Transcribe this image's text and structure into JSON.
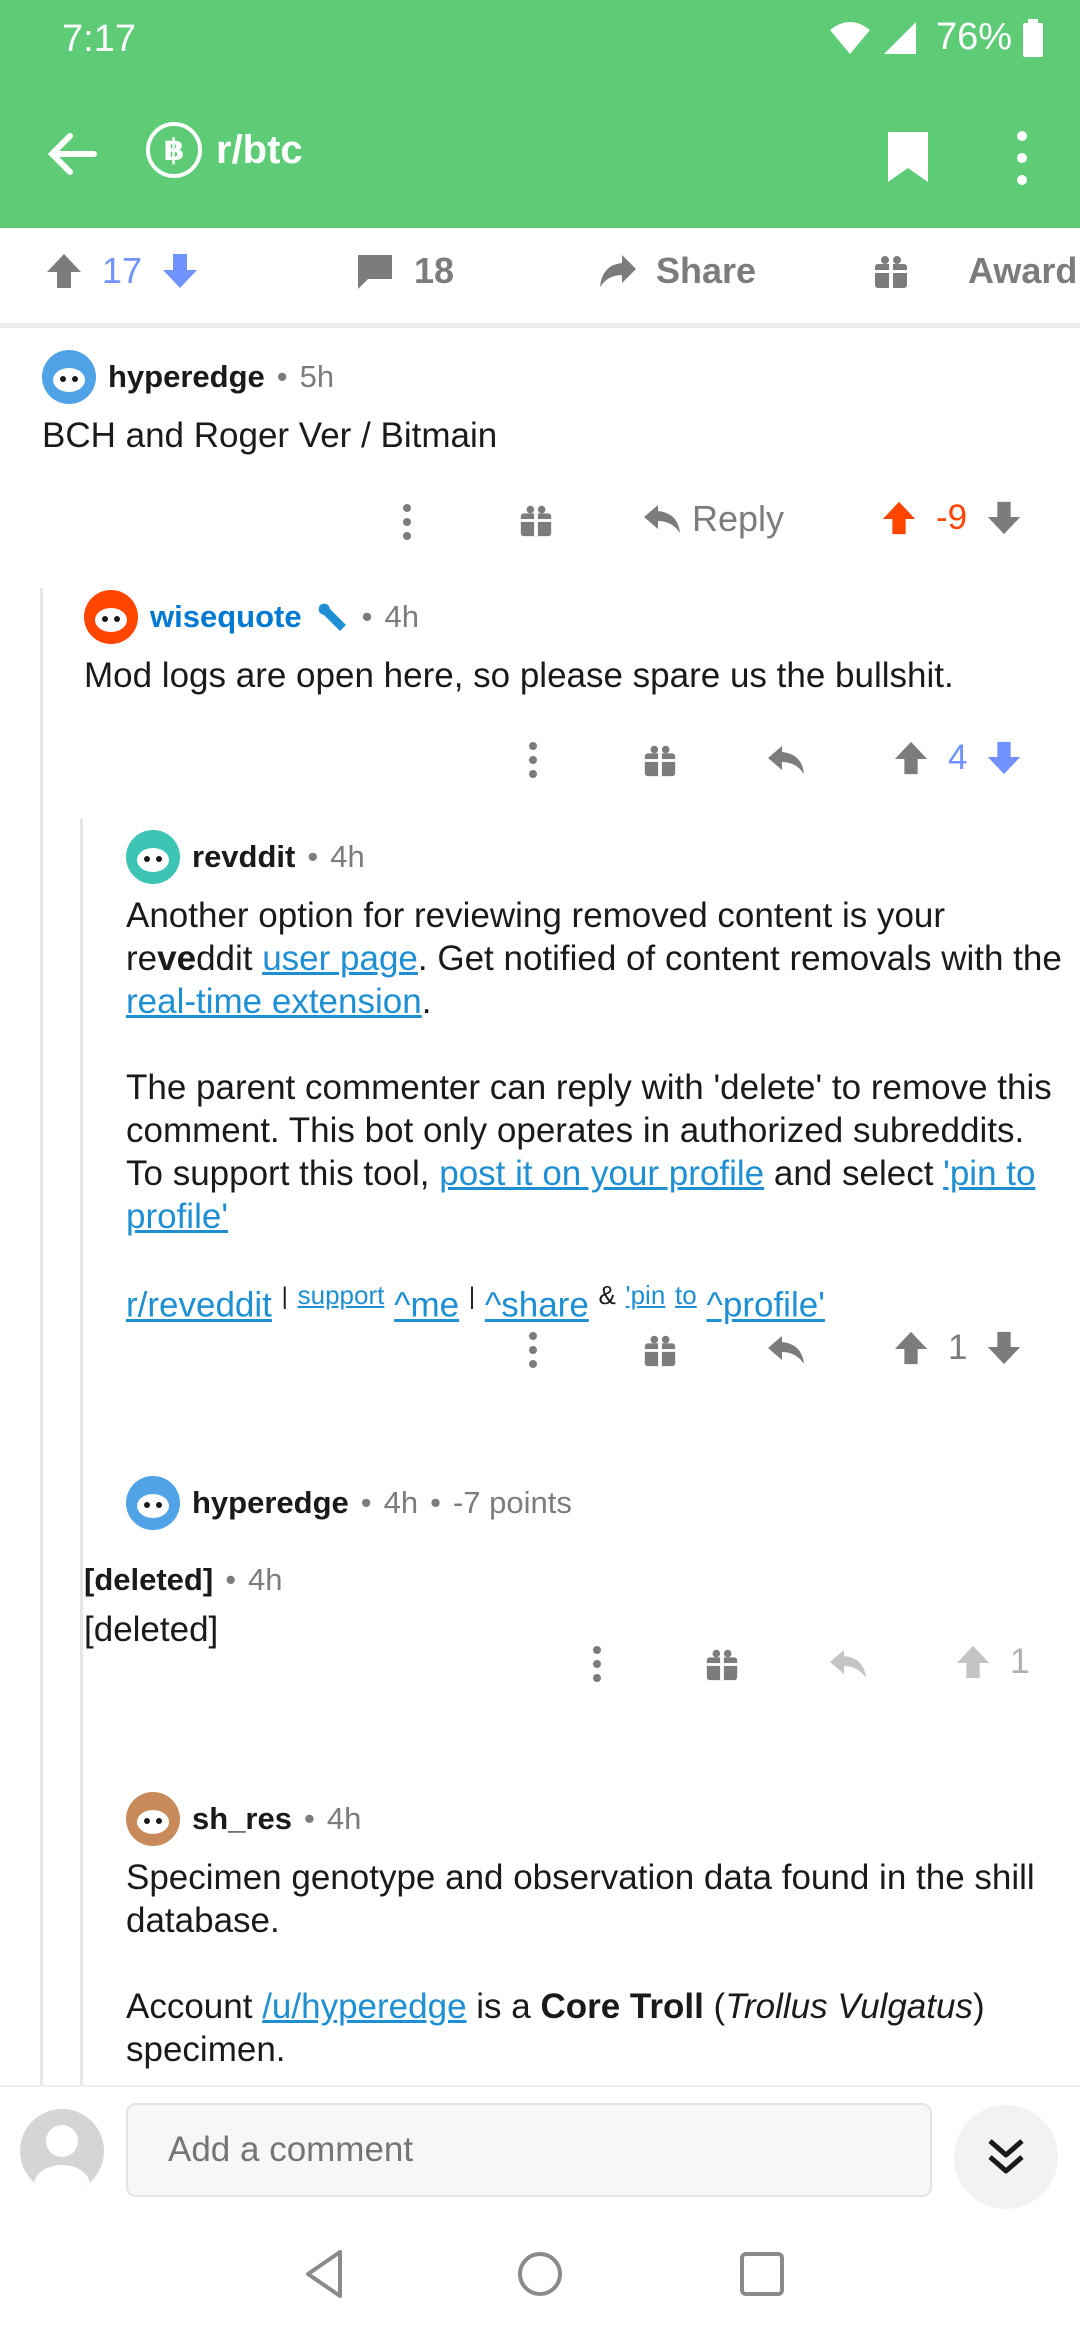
{
  "status_bar": {
    "time": "7:17",
    "battery": "76%",
    "icons": [
      "wifi-icon",
      "cell-signal-icon",
      "battery-icon"
    ]
  },
  "header": {
    "subreddit": "r/btc",
    "subreddit_icon_glyph": "฿"
  },
  "post_actions": {
    "score": "17",
    "comments": "18",
    "share": "Share",
    "award": "Award"
  },
  "comments": [
    {
      "user": "hyperedge",
      "time": "5h",
      "body": "BCH and Roger Ver / Bitmain",
      "reply": "Reply",
      "score": "-9"
    },
    {
      "user": "wisequote",
      "time": "4h",
      "body": "Mod logs are open here, so please spare us the bullshit.",
      "score": "4"
    },
    {
      "user": "revddit",
      "time": "4h",
      "p1_a": "Another option for reviewing removed content is your re",
      "p1_bold": "ve",
      "p1_b": "ddit ",
      "p1_link1": "user page",
      "p1_c": ". Get notified of content removals with the ",
      "p1_link2": "real-time extension",
      "p1_d": ".",
      "p2_a": "The parent commenter can reply with 'delete' to remove this comment. This bot only operates in authorized subreddits. To support this tool, ",
      "p2_link": "post it on your profile",
      "p2_b": " and select ",
      "p2_link2": "'pin to profile'",
      "links": {
        "reveddit": "r/reveddit",
        "sep1": "|",
        "support": "support",
        "me": "^me",
        "sep2": "|",
        "share": "^share",
        "amp": "&",
        "pin": "'pin",
        "to": "to",
        "profile": "^profile'"
      },
      "score": "1"
    },
    {
      "user": "hyperedge",
      "time": "4h",
      "points": "-7 points"
    },
    {
      "user": "[deleted]",
      "time": "4h",
      "body": "[deleted]",
      "score": "1"
    },
    {
      "user": "sh_res",
      "time": "4h",
      "p1": "Specimen genotype and observation data found in the shill database.",
      "p2_a": "Account ",
      "p2_link": "/u/hyperedge",
      "p2_b": " is a ",
      "p2_bold": "Core Troll",
      "p2_c": " (",
      "p2_ital": "Trollus Vulgatus",
      "p2_d": ")",
      "p2_e": "specimen."
    }
  ],
  "meta_sep": "•",
  "composer": {
    "placeholder": "Add a comment"
  },
  "colors": {
    "header_green": "#5ecb77",
    "upvote": "#ff4500",
    "downvote_blue": "#7193ff",
    "link": "#1f8fd4",
    "mod": "#0079d3"
  }
}
